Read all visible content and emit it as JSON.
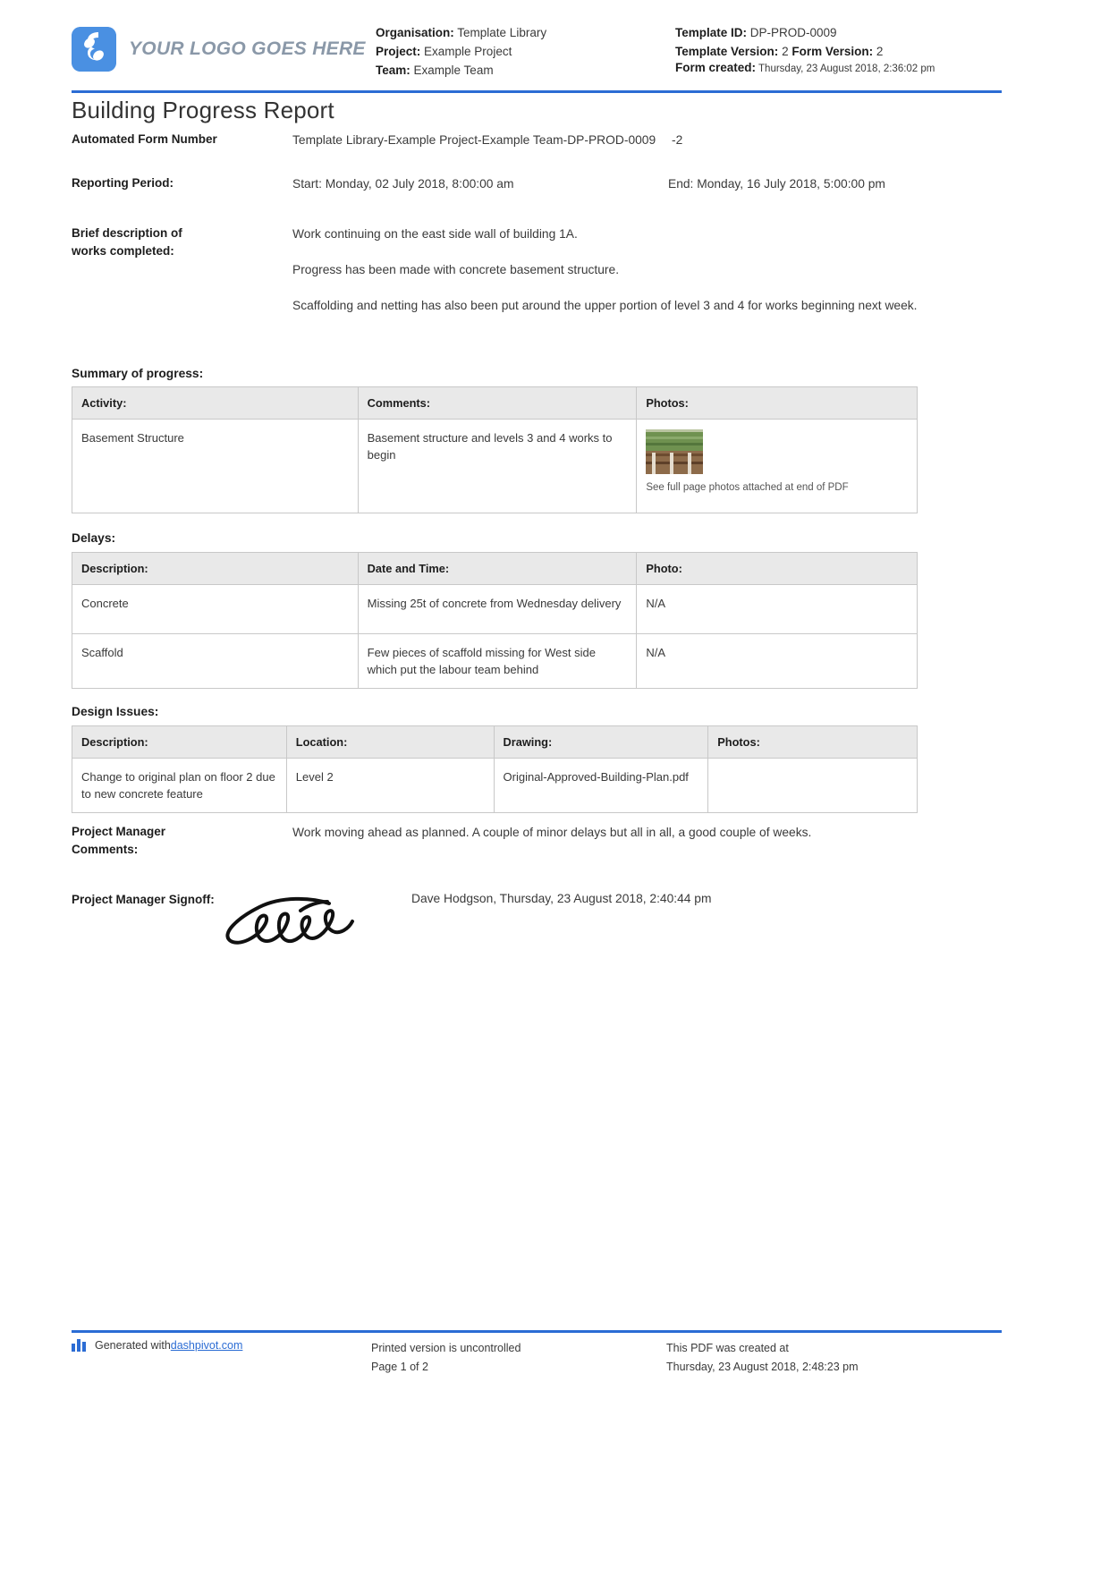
{
  "header": {
    "logo_text": "YOUR LOGO GOES HERE",
    "organisation_label": "Organisation:",
    "organisation_value": "Template Library",
    "project_label": "Project:",
    "project_value": "Example Project",
    "team_label": "Team:",
    "team_value": "Example Team",
    "template_id_label": "Template ID:",
    "template_id_value": "DP-PROD-0009",
    "template_version_label": "Template Version:",
    "template_version_value": "2",
    "form_version_label": "Form Version:",
    "form_version_value": "2",
    "form_created_label": "Form created:",
    "form_created_value": "Thursday, 23 August 2018, 2:36:02 pm"
  },
  "title": "Building Progress Report",
  "fields": {
    "form_number_label": "Automated Form Number",
    "form_number_value": "Template Library-Example Project-Example Team-DP-PROD-0009",
    "form_number_suffix": "-2",
    "reporting_period_label": "Reporting Period:",
    "reporting_start": "Start: Monday, 02 July 2018, 8:00:00 am",
    "reporting_end": "End: Monday, 16 July 2018, 5:00:00 pm",
    "brief_label": "Brief description of works completed:",
    "brief_p1": "Work continuing on the east side wall of building 1A.",
    "brief_p2": "Progress has been made with concrete basement structure.",
    "brief_p3": "Scaffolding and netting has also been put around the upper portion of level 3 and 4 for works beginning next week."
  },
  "summary": {
    "heading": "Summary of progress:",
    "columns": [
      "Activity:",
      "Comments:",
      "Photos:"
    ],
    "rows": [
      {
        "activity": "Basement Structure",
        "comments": "Basement structure and levels 3 and 4 works to begin",
        "photo_note": "See full page photos attached at end of PDF"
      }
    ]
  },
  "delays": {
    "heading": "Delays:",
    "columns": [
      "Description:",
      "Date and Time:",
      "Photo:"
    ],
    "rows": [
      {
        "description": "Concrete",
        "date_time": "Missing 25t of concrete from Wednesday delivery",
        "photo": "N/A"
      },
      {
        "description": "Scaffold",
        "date_time": "Few pieces of scaffold missing for West side which put the labour team behind",
        "photo": "N/A"
      }
    ]
  },
  "design_issues": {
    "heading": "Design Issues:",
    "columns": [
      "Description:",
      "Location:",
      "Drawing:",
      "Photos:"
    ],
    "rows": [
      {
        "description": "Change to original plan on floor 2 due to new concrete feature",
        "location": "Level 2",
        "drawing": "Original-Approved-Building-Plan.pdf",
        "photos": ""
      }
    ]
  },
  "pm_comments": {
    "label": "Project Manager Comments:",
    "value": "Work moving ahead as planned. A couple of minor delays but all in all, a good couple of weeks."
  },
  "signoff": {
    "label": "Project Manager Signoff:",
    "name_and_time": "Dave Hodgson, Thursday, 23 August 2018, 2:40:44 pm"
  },
  "footer": {
    "generated_prefix": "Generated with ",
    "generated_link": "dashpivot.com",
    "uncontrolled": "Printed version is uncontrolled",
    "page": "Page 1 of 2",
    "created_at_label": "This PDF was created at",
    "created_at_value": "Thursday, 23 August 2018, 2:48:23 pm"
  },
  "colors": {
    "accent": "#2b6cd4",
    "logo_blue": "#4a90e2",
    "table_header": "#e9e9e9",
    "border": "#c8c8c8"
  }
}
